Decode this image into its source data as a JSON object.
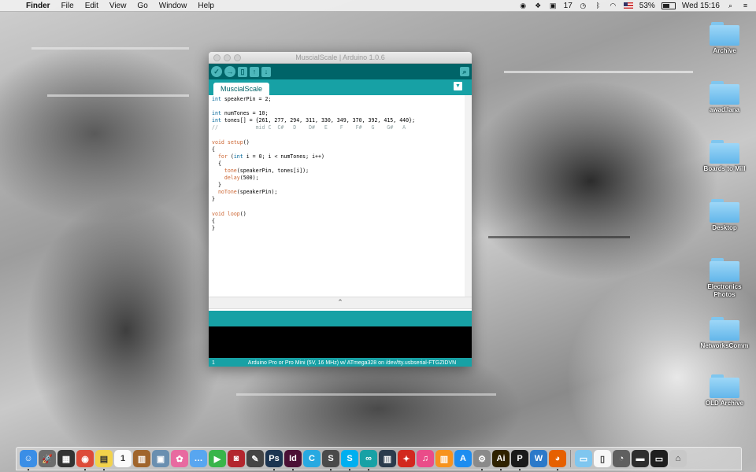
{
  "menubar": {
    "apple_icon": "",
    "items": [
      "Finder",
      "File",
      "Edit",
      "View",
      "Go",
      "Window",
      "Help"
    ],
    "status": {
      "notification_count": "17",
      "battery": "53%",
      "clock": "Wed 15:16"
    }
  },
  "window": {
    "title": "MuscialScale | Arduino 1.0.6",
    "tab_label": "MuscialScale",
    "code_lines": [
      [
        {
          "t": "int",
          "c": "kw2"
        },
        {
          "t": " speakerPin = 2;"
        }
      ],
      [],
      [
        {
          "t": "int",
          "c": "kw2"
        },
        {
          "t": " numTones = 10;"
        }
      ],
      [
        {
          "t": "int",
          "c": "kw2"
        },
        {
          "t": " tones[] = {261, 277, 294, 311, 330, 349, 370, 392, 415, 440};"
        }
      ],
      [
        {
          "t": "//            mid C  C#   D    D#   E    F    F#   G    G#   A",
          "c": "cm"
        }
      ],
      [],
      [
        {
          "t": "void",
          "c": "kw"
        },
        {
          "t": " "
        },
        {
          "t": "setup",
          "c": "kw"
        },
        {
          "t": "()"
        }
      ],
      [
        {
          "t": "{"
        }
      ],
      [
        {
          "t": "  "
        },
        {
          "t": "for",
          "c": "kw"
        },
        {
          "t": " ("
        },
        {
          "t": "int",
          "c": "kw2"
        },
        {
          "t": " i = 0; i < numTones; i++)"
        }
      ],
      [
        {
          "t": "  {"
        }
      ],
      [
        {
          "t": "    "
        },
        {
          "t": "tone",
          "c": "kw"
        },
        {
          "t": "(speakerPin, tones[i]);"
        }
      ],
      [
        {
          "t": "    "
        },
        {
          "t": "delay",
          "c": "kw"
        },
        {
          "t": "(500);"
        }
      ],
      [
        {
          "t": "  }"
        }
      ],
      [
        {
          "t": "  "
        },
        {
          "t": "noTone",
          "c": "kw"
        },
        {
          "t": "(speakerPin);"
        }
      ],
      [
        {
          "t": "}"
        }
      ],
      [],
      [
        {
          "t": "void",
          "c": "kw"
        },
        {
          "t": " "
        },
        {
          "t": "loop",
          "c": "kw"
        },
        {
          "t": "()"
        }
      ],
      [
        {
          "t": "{"
        }
      ],
      [
        {
          "t": "}"
        }
      ]
    ],
    "status_line": "1",
    "status_board": "Arduino Pro or Pro Mini (5V, 16 MHz) w/ ATmega328 on /dev/tty.usbserial-FTGZIDVN"
  },
  "desktop_icons": [
    {
      "label": "Archive",
      "icon": "folder-icon"
    },
    {
      "label": "awad.lana",
      "icon": "folder-icon"
    },
    {
      "label": "Boards to Mill",
      "icon": "folder-icon"
    },
    {
      "label": "Desktop",
      "icon": "folder-icon"
    },
    {
      "label": "Electronics Photos",
      "icon": "folder-icon"
    },
    {
      "label": "NetworksComm",
      "icon": "folder-icon"
    },
    {
      "label": "OLD Archive",
      "icon": "folder-icon"
    }
  ],
  "dock": {
    "apps": [
      {
        "name": "finder",
        "glyph": "☺",
        "color": "#3a8ee6",
        "running": true
      },
      {
        "name": "launchpad",
        "glyph": "🚀",
        "color": "#6d6d6d",
        "running": false
      },
      {
        "name": "mission-control",
        "glyph": "▦",
        "color": "#333333",
        "running": false
      },
      {
        "name": "chrome",
        "glyph": "◉",
        "color": "#dd4b39",
        "running": true
      },
      {
        "name": "stickies",
        "glyph": "▤",
        "color": "#f2d24b",
        "running": true
      },
      {
        "name": "calendar",
        "glyph": "1",
        "color": "#fafafa",
        "running": false
      },
      {
        "name": "notebook",
        "glyph": "▥",
        "color": "#a0652c",
        "running": false
      },
      {
        "name": "preview",
        "glyph": "▣",
        "color": "#6a8fb0",
        "running": false
      },
      {
        "name": "photos",
        "glyph": "✿",
        "color": "#e86aa0",
        "running": false
      },
      {
        "name": "messages",
        "glyph": "…",
        "color": "#58a6f0",
        "running": false
      },
      {
        "name": "facetime",
        "glyph": "▶",
        "color": "#39b54a",
        "running": false
      },
      {
        "name": "photo-booth",
        "glyph": "◙",
        "color": "#b3262e",
        "running": false
      },
      {
        "name": "grapher",
        "glyph": "✎",
        "color": "#444444",
        "running": false
      },
      {
        "name": "photoshop",
        "glyph": "Ps",
        "color": "#1c3552",
        "running": true
      },
      {
        "name": "indesign",
        "glyph": "Id",
        "color": "#4b1035",
        "running": true
      },
      {
        "name": "codebox",
        "glyph": "C",
        "color": "#27a9e1",
        "running": false
      },
      {
        "name": "sublime-text",
        "glyph": "S",
        "color": "#4a4a4a",
        "running": true
      },
      {
        "name": "skype",
        "glyph": "S",
        "color": "#00aff0",
        "running": true
      },
      {
        "name": "arduino",
        "glyph": "∞",
        "color": "#17a1a5",
        "running": true
      },
      {
        "name": "fritzing",
        "glyph": "▥",
        "color": "#2a3b4c",
        "running": false
      },
      {
        "name": "rosetta",
        "glyph": "✦",
        "color": "#d2281e",
        "running": false
      },
      {
        "name": "itunes",
        "glyph": "♫",
        "color": "#ea4c89",
        "running": false
      },
      {
        "name": "ibooks",
        "glyph": "▥",
        "color": "#f7931e",
        "running": false
      },
      {
        "name": "app-store",
        "glyph": "A",
        "color": "#1d8df0",
        "running": false
      },
      {
        "name": "system-preferences",
        "glyph": "⚙",
        "color": "#8a8a8a",
        "running": true
      },
      {
        "name": "illustrator",
        "glyph": "Ai",
        "color": "#2f2200",
        "running": true
      },
      {
        "name": "pages",
        "glyph": "P",
        "color": "#1a1a1a",
        "running": true
      },
      {
        "name": "word",
        "glyph": "W",
        "color": "#2b79c9",
        "running": false
      },
      {
        "name": "firefox",
        "glyph": "◕",
        "color": "#e66000",
        "running": true
      },
      {
        "name": "applications-folder",
        "glyph": "▭",
        "color": "#7fc6ef",
        "running": false
      },
      {
        "name": "document",
        "glyph": "▯",
        "color": "#f7f7f7",
        "running": false
      },
      {
        "name": "downloads-stack",
        "glyph": "◔",
        "color": "#606060",
        "running": false
      },
      {
        "name": "screenshot-stack",
        "glyph": "▬",
        "color": "#2d2d2d",
        "running": false
      },
      {
        "name": "monitor-stack",
        "glyph": "▭",
        "color": "#1f1f1f",
        "running": false
      },
      {
        "name": "trash",
        "glyph": "⌂",
        "color": "#c8c8c8",
        "running": false
      }
    ]
  }
}
